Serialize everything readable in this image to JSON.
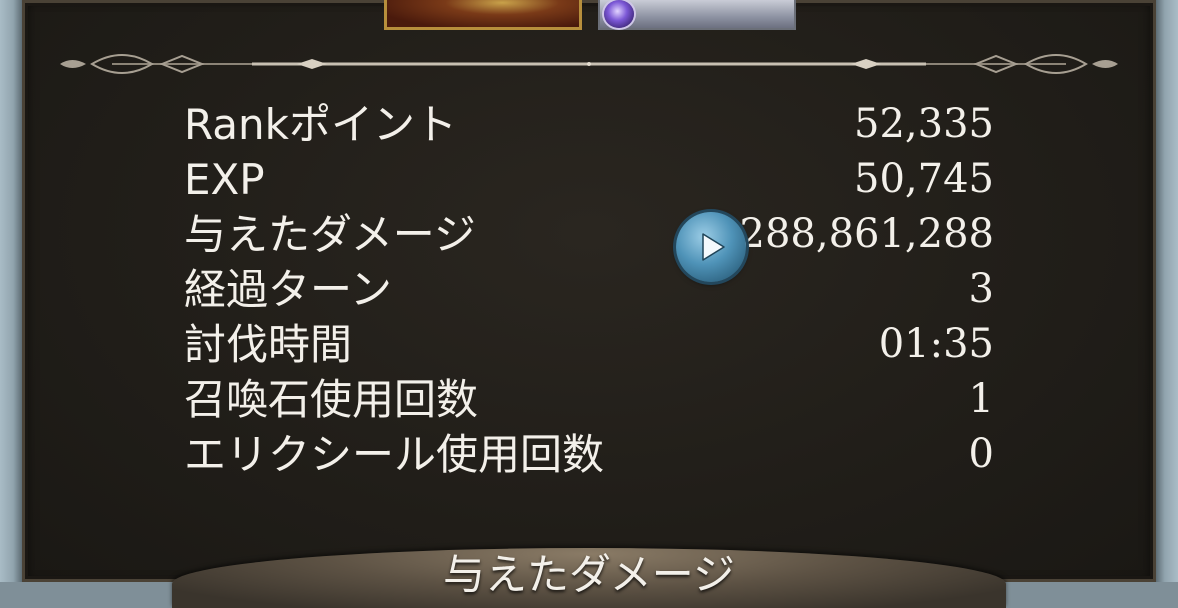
{
  "results": {
    "rows": [
      {
        "label": "Rankポイント",
        "value": "52,335"
      },
      {
        "label": "EXP",
        "value": "50,745"
      },
      {
        "label": "与えたダメージ",
        "value": "288,861,288"
      },
      {
        "label": "経過ターン",
        "value": "3"
      },
      {
        "label": "討伐時間",
        "value": "01:35"
      },
      {
        "label": "召喚石使用回数",
        "value": "1"
      },
      {
        "label": "エリクシール使用回数",
        "value": "0"
      }
    ]
  },
  "bottom_tab": {
    "label": "与えたダメージ"
  },
  "icons": {
    "play_button": "play-triangle-icon",
    "summon_gem": "dark-element-gem-icon"
  },
  "colors": {
    "panel_background": "#211e19",
    "text": "#f3f0ea",
    "play_button": "#4f93b8",
    "card_border_gold": "#b78f3c"
  }
}
